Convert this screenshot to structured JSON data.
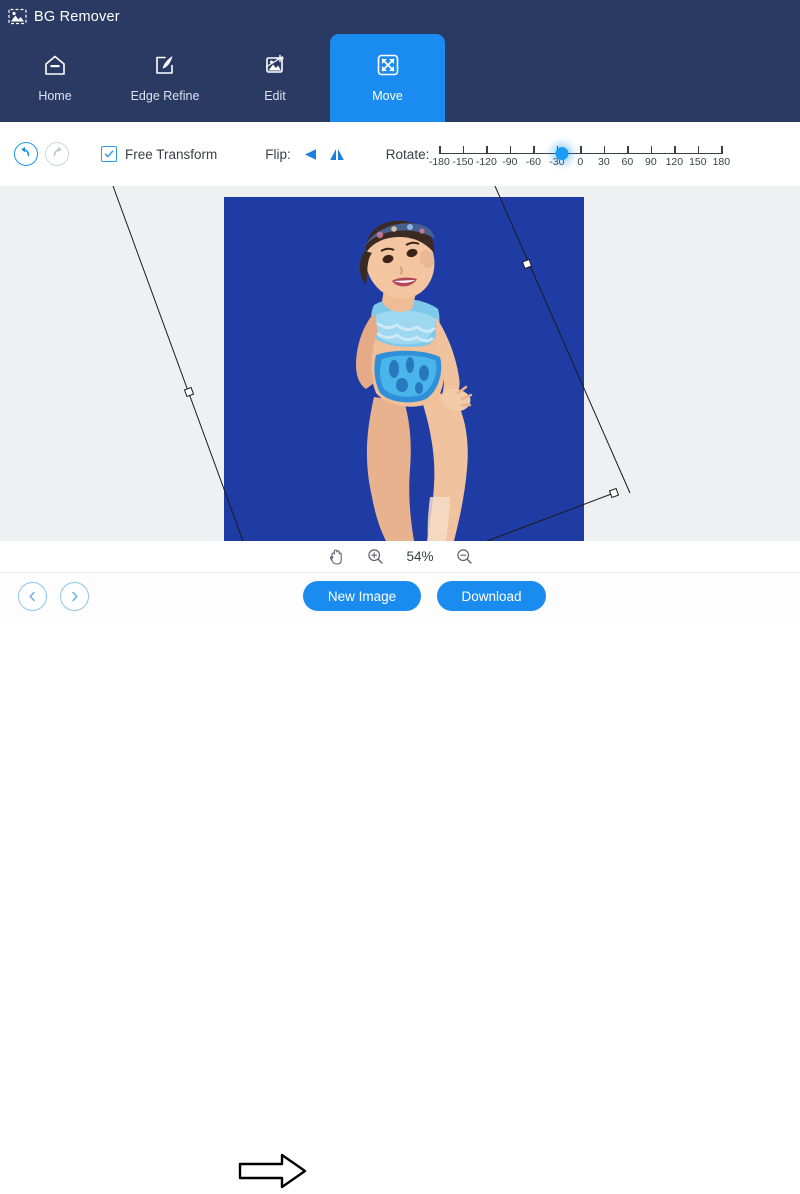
{
  "app": {
    "title": "BG Remover",
    "logo_icon": "image-logo-icon"
  },
  "nav": {
    "items": [
      {
        "label": "Home",
        "icon": "home-icon",
        "active": false
      },
      {
        "label": "Edge Refine",
        "icon": "pen-edit-icon",
        "active": false
      },
      {
        "label": "Edit",
        "icon": "image-edit-icon",
        "active": false
      },
      {
        "label": "Move",
        "icon": "move-arrows-icon",
        "active": true
      }
    ]
  },
  "toolbar": {
    "undo_icon": "undo-arrow-icon",
    "redo_icon": "redo-arrow-icon",
    "undo_enabled": "true",
    "redo_enabled": "false",
    "free_transform_label": "Free Transform",
    "free_transform_checked": "true",
    "flip_label": "Flip:",
    "flip_vertical_icon": "flip-vertical-icon",
    "flip_horizontal_icon": "flip-horizontal-icon",
    "rotate_label": "Rotate:",
    "rotate_value": -23,
    "rotate_min": -180,
    "rotate_max": 180,
    "rotate_ticks": [
      "-180",
      "-150",
      "-120",
      "-90",
      "-60",
      "-30",
      "0",
      "30",
      "60",
      "90",
      "120",
      "150",
      "180"
    ]
  },
  "canvas": {
    "background_color": "#eef0f2",
    "image_background_color": "#1f3ba4",
    "subject_alt": "toddler in blue swimsuit",
    "transform_handles": [
      "left-mid-handle",
      "right-mid-handle",
      "bottom-right-corner-handle"
    ]
  },
  "zoombar": {
    "hand_icon": "hand-tool-icon",
    "zoom_in_icon": "zoom-in-icon",
    "zoom_out_icon": "zoom-out-icon",
    "zoom_level": "54%"
  },
  "footer": {
    "prev_icon": "chevron-left-icon",
    "next_icon": "chevron-right-icon",
    "new_image_label": "New Image",
    "download_label": "Download",
    "pointer_icon": "arrow-pointer-right-icon"
  },
  "colors": {
    "header_bg": "#2b3a63",
    "accent": "#1a8cf0",
    "canvas_bg": "#eef0f2",
    "photo_bg": "#1f3ba4"
  }
}
